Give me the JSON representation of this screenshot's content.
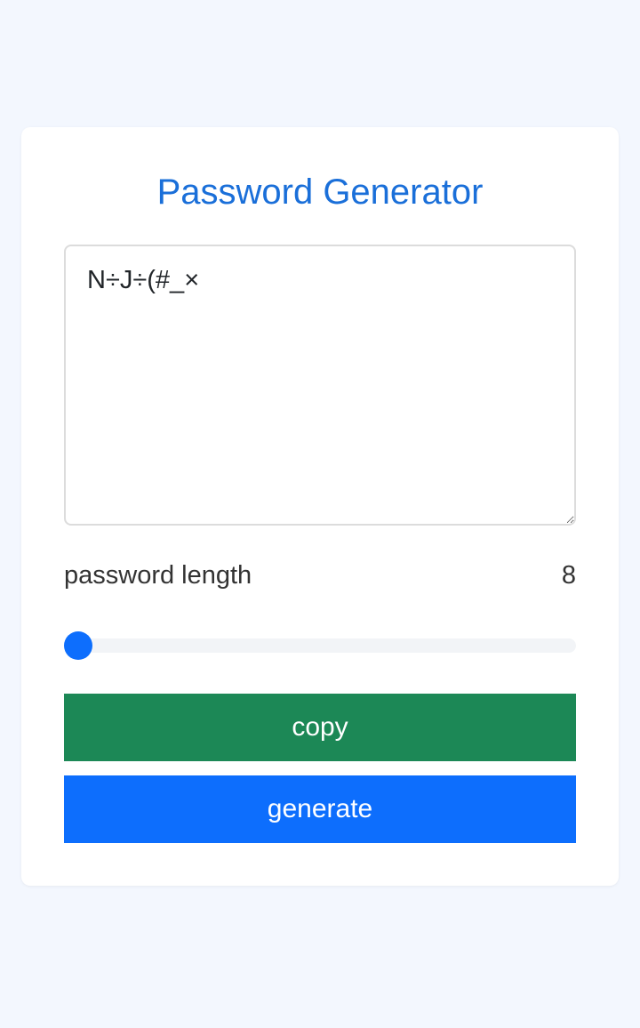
{
  "app": {
    "title": "Password Generator"
  },
  "output": {
    "password": "N÷J÷(#_×"
  },
  "length": {
    "label": "password length",
    "value": "8",
    "slider_fraction": 0.0
  },
  "buttons": {
    "copy_label": "copy",
    "generate_label": "generate"
  },
  "colors": {
    "title": "#1a6fd9",
    "copy_button": "#1c8856",
    "generate_button": "#0d6efd",
    "slider_thumb": "#0d6efd",
    "page_background": "#f3f7fe"
  }
}
